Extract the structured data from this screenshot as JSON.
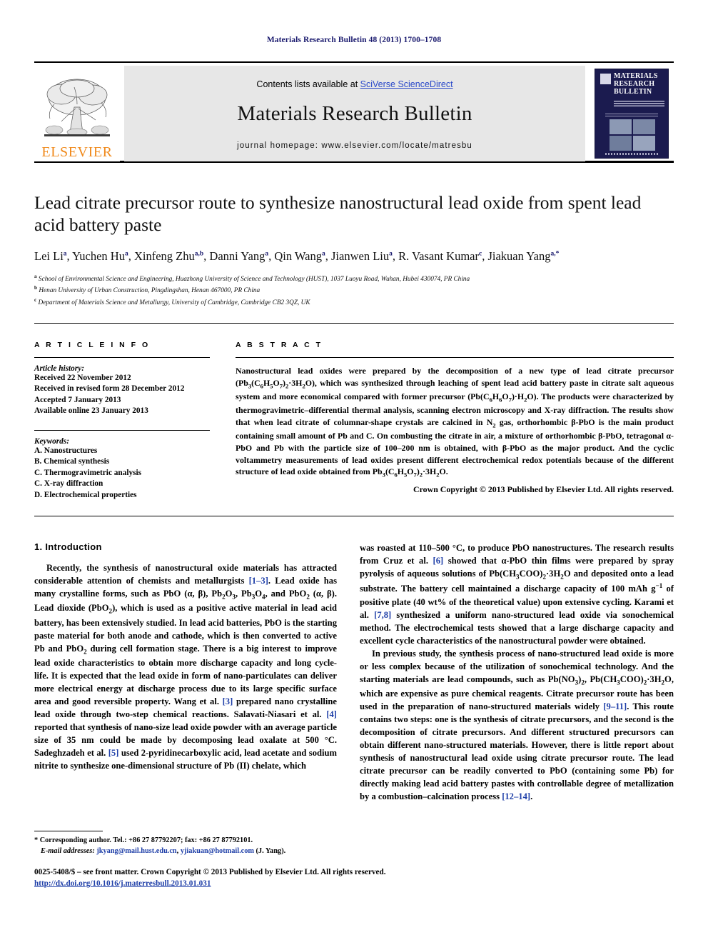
{
  "running_head": "Materials Research Bulletin 48 (2013) 1700–1708",
  "masthead": {
    "contents_prefix": "Contents lists available at ",
    "sciencedirect": "SciVerse ScienceDirect",
    "journal_title": "Materials Research Bulletin",
    "homepage": "journal homepage: www.elsevier.com/locate/matresbu",
    "publisher_logo_text": "ELSEVIER",
    "cover": {
      "line1": "MATERIALS",
      "line2": "RESEARCH",
      "line3": "BULLETIN"
    },
    "accent_link_color": "#2a49c9",
    "elsevier_orange": "#f08a1c",
    "cover_navy": "#1b1b4f"
  },
  "article": {
    "title": "Lead citrate precursor route to synthesize nanostructural lead oxide from spent lead acid battery paste",
    "authors_html": "Lei Li<sup>a</sup>, Yuchen Hu<sup>a</sup>, Xinfeng Zhu<sup>a,b</sup>, Danni Yang<sup>a</sup>, Qin Wang<sup>a</sup>, Jianwen Liu<sup>a</sup>, R. Vasant Kumar<sup>c</sup>, Jiakuan Yang<sup>a,*</sup>",
    "affiliations": [
      "<sup>a</sup> School of Environmental Science and Engineering, Huazhong University of Science and Technology (HUST), 1037 Luoyu Road, Wuhan, Hubei 430074, PR China",
      "<sup>b</sup> Henan University of Urban Construction, Pingdingshan, Henan 467000, PR China",
      "<sup>c</sup> Department of Materials Science and Metallurgy, University of Cambridge, Cambridge CB2 3QZ, UK"
    ]
  },
  "info": {
    "heading": "A R T I C L E  I N F O",
    "history_title": "Article history:",
    "history": [
      "Received 22 November 2012",
      "Received in revised form 28 December 2012",
      "Accepted 7 January 2013",
      "Available online 23 January 2013"
    ],
    "keywords_title": "Keywords:",
    "keywords": [
      "A. Nanostructures",
      "B. Chemical synthesis",
      "C. Thermogravimetric analysis",
      "C. X-ray diffraction",
      "D. Electrochemical properties"
    ]
  },
  "abstract": {
    "heading": "A B S T R A C T",
    "body_html": "Nanostructural lead oxides were prepared by the decomposition of a new type of lead citrate precursor (Pb<sub>3</sub>(C<sub>6</sub>H<sub>5</sub>O<sub>7</sub>)<sub>2</sub>&middot;3H<sub>2</sub>O), which was synthesized through leaching of spent lead acid battery paste in citrate salt aqueous system and more economical compared with former precursor (Pb(C<sub>6</sub>H<sub>6</sub>O<sub>7</sub>)&middot;H<sub>2</sub>O). The products were characterized by thermogravimetric&ndash;differential thermal analysis, scanning electron microscopy and X-ray diffraction. The results show that when lead citrate of columnar-shape crystals are calcined in N<sub>2</sub> gas, orthorhombic &beta;-PbO is the main product containing small amount of Pb and C. On combusting the citrate in air, a mixture of orthorhombic &beta;-PbO, tetragonal &alpha;-PbO and Pb with the particle size of 100&ndash;200 nm is obtained, with &beta;-PbO as the major product. And the cyclic voltammetry measurements of lead oxides present different electrochemical redox potentials because of the different structure of lead oxide obtained from Pb<sub>3</sub>(C<sub>6</sub>H<sub>5</sub>O<sub>7</sub>)<sub>2</sub>&middot;3H<sub>2</sub>O.",
    "copyright": "Crown Copyright &copy; 2013 Published by Elsevier Ltd. All rights reserved."
  },
  "body": {
    "section1_title": "1.  Introduction",
    "left_paragraphs_html": [
      "Recently, the synthesis of nanostructural oxide materials has attracted considerable attention of chemists and metallurgists <span class=\"ref\">[1&ndash;3]</span>. Lead oxide has many crystalline forms, such as PbO (&alpha;, &beta;), Pb<sub>2</sub>O<sub>3</sub>, Pb<sub>3</sub>O<sub>4</sub>, and PbO<sub>2</sub> (&alpha;, &beta;). Lead dioxide (PbO<sub>2</sub>), which is used as a positive active material in lead acid battery, has been extensively studied. In lead acid batteries, PbO is the starting paste material for both anode and cathode, which is then converted to active Pb and PbO<sub>2</sub> during cell formation stage. There is a big interest to improve lead oxide characteristics to obtain more discharge capacity and long cycle-life. It is expected that the lead oxide in form of nano-particulates can deliver more electrical energy at discharge process due to its large specific surface area and good reversible property. Wang et al. <span class=\"ref\">[3]</span> prepared nano crystalline lead oxide through two-step chemical reactions. Salavati-Niasari et al. <span class=\"ref\">[4]</span> reported that synthesis of nano-size lead oxide powder with an average particle size of 35 nm could be made by decomposing lead oxalate at 500 &deg;C. Sadeghzadeh et al. <span class=\"ref\">[5]</span> used 2-pyridinecarboxylic acid, lead acetate and sodium nitrite to synthesize one-dimensional structure of Pb (II) chelate, which"
    ],
    "right_paragraphs_html": [
      "was roasted at 110&ndash;500 &deg;C, to produce PbO nanostructures. The research results from Cruz et al. <span class=\"ref\">[6]</span> showed that &alpha;-PbO thin films were prepared by spray pyrolysis of aqueous solutions of Pb(CH<sub>3</sub>COO)<sub>2</sub>&middot;3H<sub>2</sub>O and deposited onto a lead substrate. The battery cell maintained a discharge capacity of 100 mAh g<sup class=\"sm\">&minus;1</sup> of positive plate (40 wt% of the theoretical value) upon extensive cycling. Karami et al. <span class=\"ref\">[7,8]</span> synthesized a uniform nano-structured lead oxide via sonochemical method. The electrochemical tests showed that a large discharge capacity and excellent cycle characteristics of the nanostructural powder were obtained.",
      "In previous study, the synthesis process of nano-structured lead oxide is more or less complex because of the utilization of sonochemical technology. And the starting materials are lead compounds, such as Pb(NO<sub>3</sub>)<sub>2</sub>, Pb(CH<sub>3</sub>COO)<sub>2</sub>&middot;3H<sub>2</sub>O, which are expensive as pure chemical reagents. Citrate precursor route has been used in the preparation of nano-structured materials widely <span class=\"ref\">[9&ndash;11]</span>. This route contains two steps: one is the synthesis of citrate precursors, and the second is the decomposition of citrate precursors. And different structured precursors can obtain different nano-structured materials. However, there is little report about synthesis of nanostructural lead oxide using citrate precursor route. The lead citrate precursor can be readily converted to PbO (containing some Pb) for directly making lead acid battery pastes with controllable degree of metallization by a combustion&ndash;calcination process <span class=\"ref\">[12&ndash;14]</span>."
    ]
  },
  "footnote": {
    "corresponding_html": "*  Corresponding author. Tel.: +86 27 87792207; fax: +86 27 87792101.",
    "email_html": "<span class=\"em\">E-mail addresses:</span> <span class=\"mail\">jkyang@mail.hust.edu.cn</span>, <span class=\"mail\">yjiakuan@hotmail.com</span> (J. Yang)."
  },
  "footer": {
    "issn_line": "0025-5408/$ &ndash; see front matter. Crown Copyright &copy; 2013 Published by Elsevier Ltd. All rights reserved.",
    "doi": "http://dx.doi.org/10.1016/j.materresbull.2013.01.031"
  }
}
